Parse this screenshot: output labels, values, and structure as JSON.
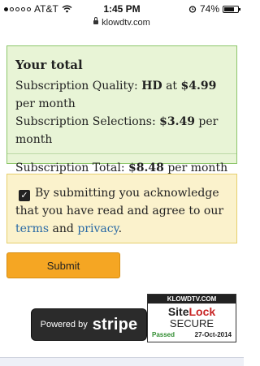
{
  "status_bar": {
    "carrier": "AT&T",
    "time": "1:45 PM",
    "battery_percent": "74%",
    "battery_level": 0.74
  },
  "url_bar": {
    "domain": "klowdtv.com"
  },
  "total_box": {
    "title": "Your total",
    "quality_label": "Subscription Quality:",
    "quality_value": "HD",
    "quality_at": "at",
    "quality_price": "$4.99",
    "quality_per": "per month",
    "selections_label": "Subscription Selections:",
    "selections_price": "$3.49",
    "selections_per": "per month",
    "total_label": "Subscription Total:",
    "total_price": "$8.48",
    "total_per": "per month"
  },
  "acknowledge": {
    "checked": true,
    "text_before": "By submitting you acknowledge that you have read and agree to our",
    "terms_link": "terms",
    "and": "and",
    "privacy_link": "privacy",
    "period": "."
  },
  "submit_button": {
    "label": "Submit"
  },
  "stripe_badge": {
    "powered_by": "Powered by",
    "brand": "stripe"
  },
  "sitelock_badge": {
    "domain": "KLOWDTV.COM",
    "brand_a": "Site",
    "brand_b": "Lock",
    "secure": "SECURE",
    "passed": "Passed",
    "date": "27-Oct-2014"
  },
  "colors": {
    "total_bg": "#e8f4d6",
    "ack_bg": "#fbf2cc",
    "submit": "#f5a623",
    "link": "#2a6aa5"
  }
}
